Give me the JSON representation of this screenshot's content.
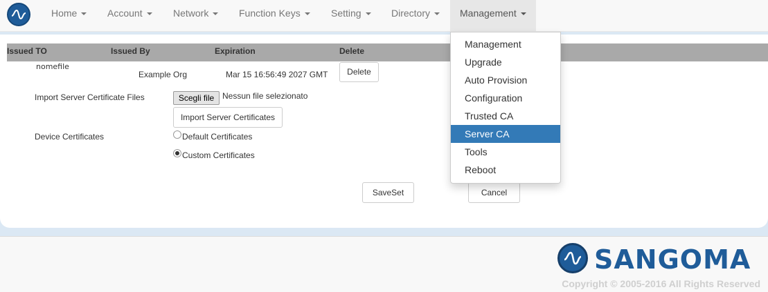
{
  "nav": {
    "items": [
      {
        "label": "Home"
      },
      {
        "label": "Account"
      },
      {
        "label": "Network"
      },
      {
        "label": "Function Keys"
      },
      {
        "label": "Setting"
      },
      {
        "label": "Directory"
      },
      {
        "label": "Management"
      }
    ]
  },
  "dropdown": {
    "items": [
      {
        "label": "Management"
      },
      {
        "label": "Upgrade"
      },
      {
        "label": "Auto Provision"
      },
      {
        "label": "Configuration"
      },
      {
        "label": "Trusted CA"
      },
      {
        "label": "Server CA"
      },
      {
        "label": "Tools"
      },
      {
        "label": "Reboot"
      }
    ],
    "selected": "Server CA"
  },
  "table": {
    "headers": [
      "Issued TO",
      "Issued By",
      "Expiration",
      "Delete"
    ],
    "rows": [
      {
        "issued_to": "nomefile",
        "issued_by": "Example Org",
        "expiration": "Mar 15 16:56:49 2027 GMT",
        "delete_label": "Delete"
      }
    ]
  },
  "import": {
    "label": "Import Server Certificate Files",
    "choose_file_label": "Scegli file",
    "no_file_text": "Nessun file selezionato",
    "import_button": "Import Server Certificates"
  },
  "device_certs": {
    "label": "Device Certificates",
    "options": [
      {
        "label": "Default Certificates",
        "checked": false
      },
      {
        "label": "Custom Certificates",
        "checked": true
      }
    ]
  },
  "actions": {
    "save_label": "SaveSet",
    "cancel_label": "Cancel"
  },
  "footer": {
    "brand": "SANGOMA",
    "copyright": "Copyright © 2005-2016 All Rights Reserved"
  },
  "colors": {
    "accent": "#337ab7",
    "brand": "#1f5c99"
  }
}
